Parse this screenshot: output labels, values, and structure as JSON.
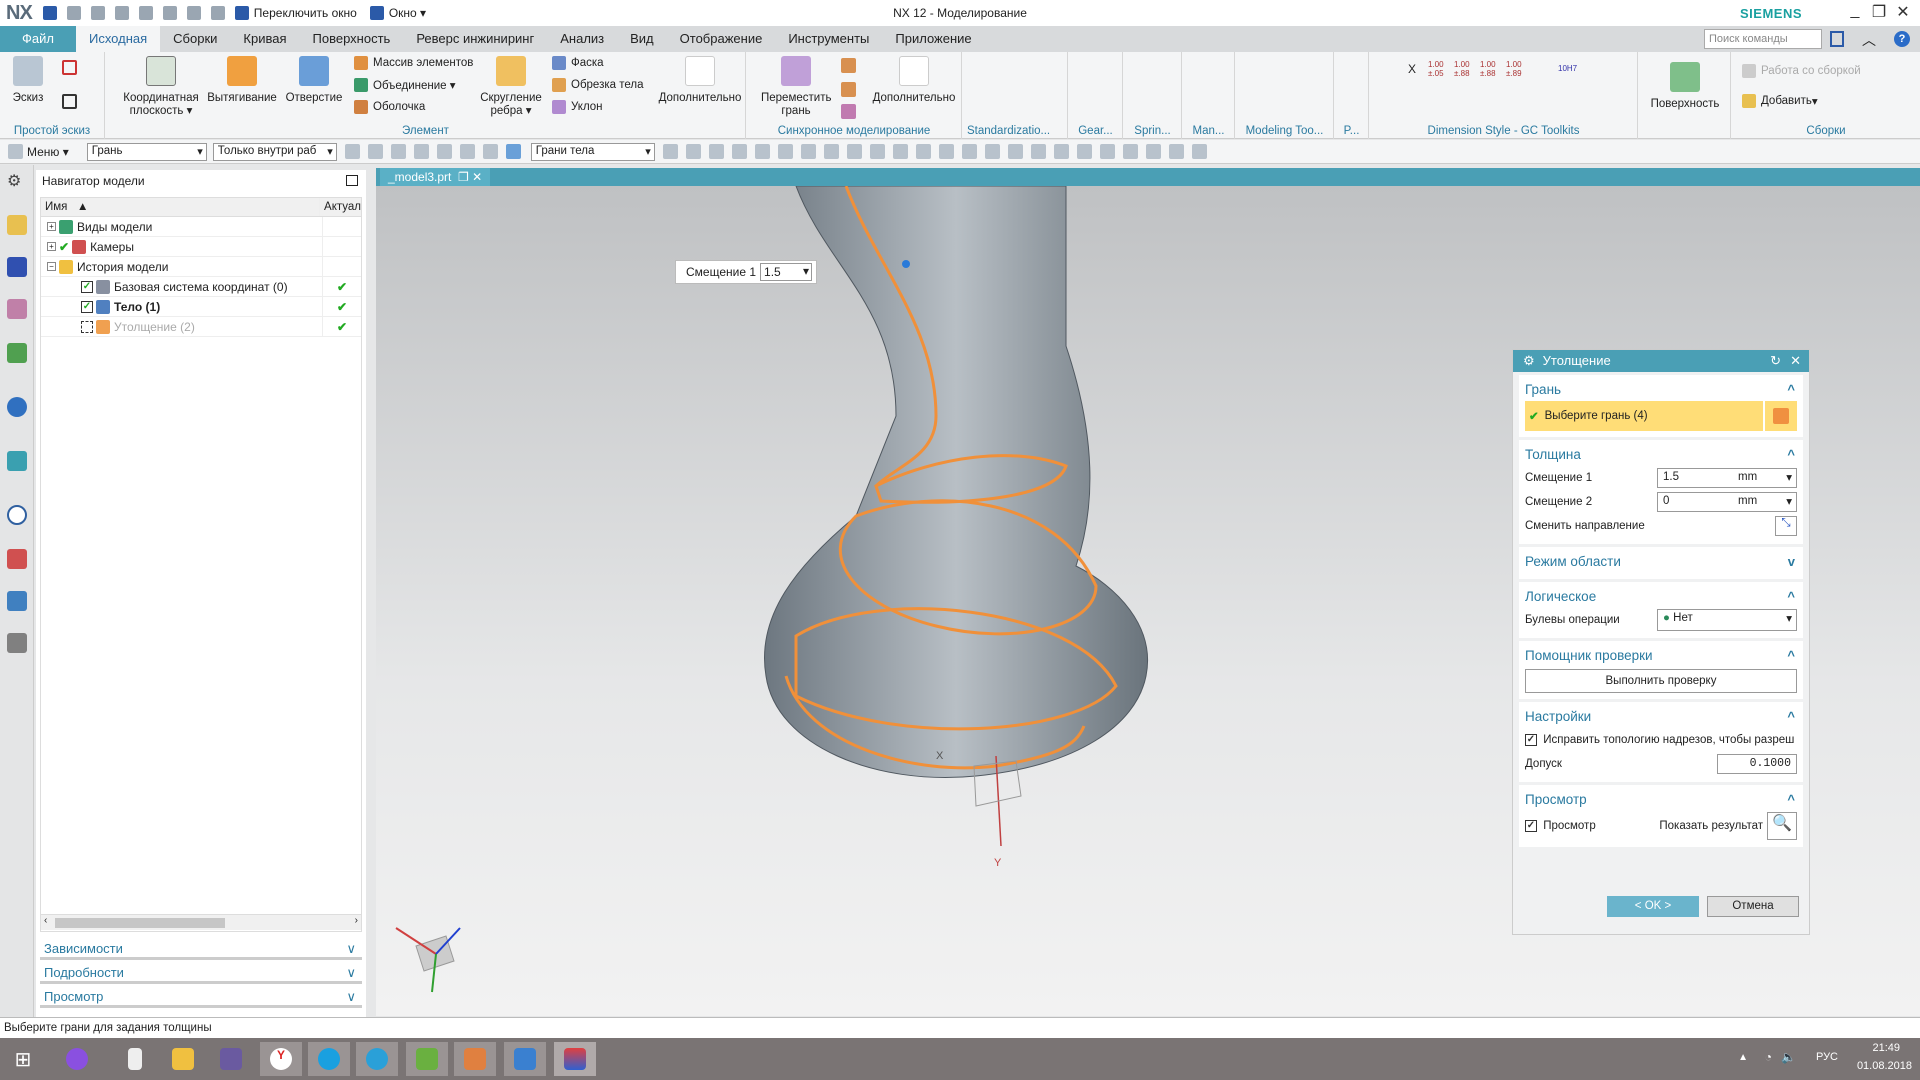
{
  "titlebar": {
    "logo": "NX",
    "switch_window": "Переключить окно",
    "window": "Окно ▾",
    "title": "NX 12 - Моделирование",
    "brand": "SIEMENS"
  },
  "tabs": [
    "Файл",
    "Исходная",
    "Сборки",
    "Кривая",
    "Поверхность",
    "Реверс инжиниринг",
    "Анализ",
    "Вид",
    "Отображение",
    "Инструменты",
    "Приложение"
  ],
  "search_placeholder": "Поиск команды",
  "ribbon": {
    "sketch": {
      "btn": "Эскиз",
      "label": "Простой эскиз"
    },
    "element": {
      "datum": "Координатная плоскость ▾",
      "extrude": "Вытягивание",
      "hole": "Отверстие",
      "pattern": "Массив элементов",
      "unite": "Объединение ▾",
      "shell": "Оболочка",
      "blend": "Скругление ребра ▾",
      "chamfer": "Фаска",
      "trim": "Обрезка тела",
      "draft": "Уклон",
      "more": "Дополнительно",
      "label": "Элемент"
    },
    "sync": {
      "move_face": "Переместить грань",
      "more": "Дополнительно",
      "label": "Синхронное моделирование"
    },
    "small_groups": [
      "Standardizatio...",
      "Gear...",
      "Sprin...",
      "Man...",
      "Modeling Too...",
      "P..."
    ],
    "dimstyle": {
      "label": "Dimension Style - GC Toolkits",
      "items": [
        "X",
        "1.00 ±.05",
        "1.00 ±.88",
        "1.00 ±.88",
        "1.00 ±.89",
        "10H7"
      ]
    },
    "surface": {
      "btn": "Поверхность"
    },
    "assemblies": {
      "work": "Работа со сборкой",
      "add": "Добавить",
      "label": "Сборки"
    }
  },
  "toolbar": {
    "menu": "Меню",
    "filter": "Грань",
    "scope": "Только внутри раб",
    "face_rule": "Грани тела"
  },
  "navigator": {
    "title": "Навигатор модели",
    "col_name": "Имя",
    "col_status": "Актуал",
    "rows": [
      {
        "label": "Виды модели",
        "status": ""
      },
      {
        "label": "Камеры",
        "status": ""
      },
      {
        "label": "История модели",
        "status": ""
      },
      {
        "label": "Базовая система координат (0)",
        "status": "✔"
      },
      {
        "label": "Тело (1)",
        "status": "✔"
      },
      {
        "label": "Утолщение (2)",
        "status": "✔"
      }
    ],
    "panels": [
      "Зависимости",
      "Подробности",
      "Просмотр"
    ]
  },
  "viewport": {
    "tab": "_model3.prt",
    "offset_label": "Смещение 1",
    "offset_value": "1.5",
    "axis_x": "X",
    "axis_y": "Y"
  },
  "dialog": {
    "title": "Утолщение",
    "face": {
      "header": "Грань",
      "select": "Выберите грань (4)"
    },
    "thickness": {
      "header": "Толщина",
      "offset1_label": "Смещение 1",
      "offset1_value": "1.5",
      "offset1_unit": "mm",
      "offset2_label": "Смещение 2",
      "offset2_value": "0",
      "offset2_unit": "mm",
      "reverse": "Сменить направление"
    },
    "region": {
      "header": "Режим области"
    },
    "boolean": {
      "header": "Логическое",
      "label": "Булевы операции",
      "value": "Нет"
    },
    "check": {
      "header": "Помощник проверки",
      "button": "Выполнить проверку"
    },
    "settings": {
      "header": "Настройки",
      "fix": "Исправить топологию надрезов, чтобы разреш",
      "tol_label": "Допуск",
      "tol_value": "0.1000"
    },
    "preview": {
      "header": "Просмотр",
      "checkbox": "Просмотр",
      "show": "Показать результат"
    },
    "ok": "< OK >",
    "cancel": "Отмена"
  },
  "status": "Выберите грани для задания толщины",
  "tray": {
    "lang": "РУС",
    "time": "21:49",
    "date": "01.08.2018"
  },
  "colors": {
    "accent": "#4a9fb5",
    "highlight": "#ffdd77",
    "edge": "#f0903a"
  }
}
